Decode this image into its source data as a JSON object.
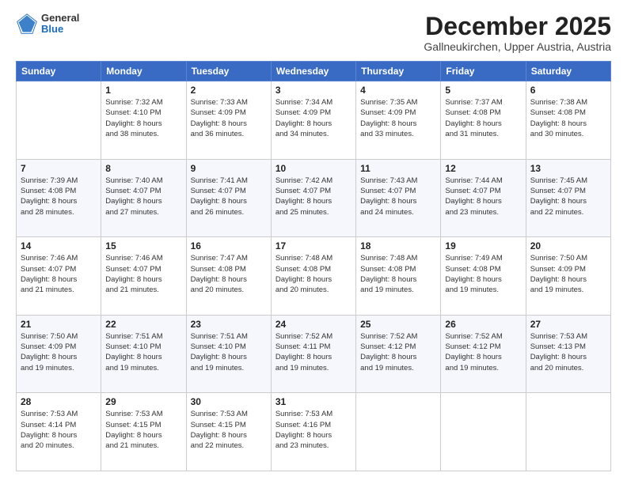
{
  "logo": {
    "general": "General",
    "blue": "Blue"
  },
  "title": "December 2025",
  "location": "Gallneukirchen, Upper Austria, Austria",
  "weekdays": [
    "Sunday",
    "Monday",
    "Tuesday",
    "Wednesday",
    "Thursday",
    "Friday",
    "Saturday"
  ],
  "weeks": [
    [
      {
        "day": "",
        "info": ""
      },
      {
        "day": "1",
        "info": "Sunrise: 7:32 AM\nSunset: 4:10 PM\nDaylight: 8 hours\nand 38 minutes."
      },
      {
        "day": "2",
        "info": "Sunrise: 7:33 AM\nSunset: 4:09 PM\nDaylight: 8 hours\nand 36 minutes."
      },
      {
        "day": "3",
        "info": "Sunrise: 7:34 AM\nSunset: 4:09 PM\nDaylight: 8 hours\nand 34 minutes."
      },
      {
        "day": "4",
        "info": "Sunrise: 7:35 AM\nSunset: 4:09 PM\nDaylight: 8 hours\nand 33 minutes."
      },
      {
        "day": "5",
        "info": "Sunrise: 7:37 AM\nSunset: 4:08 PM\nDaylight: 8 hours\nand 31 minutes."
      },
      {
        "day": "6",
        "info": "Sunrise: 7:38 AM\nSunset: 4:08 PM\nDaylight: 8 hours\nand 30 minutes."
      }
    ],
    [
      {
        "day": "7",
        "info": "Sunrise: 7:39 AM\nSunset: 4:08 PM\nDaylight: 8 hours\nand 28 minutes."
      },
      {
        "day": "8",
        "info": "Sunrise: 7:40 AM\nSunset: 4:07 PM\nDaylight: 8 hours\nand 27 minutes."
      },
      {
        "day": "9",
        "info": "Sunrise: 7:41 AM\nSunset: 4:07 PM\nDaylight: 8 hours\nand 26 minutes."
      },
      {
        "day": "10",
        "info": "Sunrise: 7:42 AM\nSunset: 4:07 PM\nDaylight: 8 hours\nand 25 minutes."
      },
      {
        "day": "11",
        "info": "Sunrise: 7:43 AM\nSunset: 4:07 PM\nDaylight: 8 hours\nand 24 minutes."
      },
      {
        "day": "12",
        "info": "Sunrise: 7:44 AM\nSunset: 4:07 PM\nDaylight: 8 hours\nand 23 minutes."
      },
      {
        "day": "13",
        "info": "Sunrise: 7:45 AM\nSunset: 4:07 PM\nDaylight: 8 hours\nand 22 minutes."
      }
    ],
    [
      {
        "day": "14",
        "info": "Sunrise: 7:46 AM\nSunset: 4:07 PM\nDaylight: 8 hours\nand 21 minutes."
      },
      {
        "day": "15",
        "info": "Sunrise: 7:46 AM\nSunset: 4:07 PM\nDaylight: 8 hours\nand 21 minutes."
      },
      {
        "day": "16",
        "info": "Sunrise: 7:47 AM\nSunset: 4:08 PM\nDaylight: 8 hours\nand 20 minutes."
      },
      {
        "day": "17",
        "info": "Sunrise: 7:48 AM\nSunset: 4:08 PM\nDaylight: 8 hours\nand 20 minutes."
      },
      {
        "day": "18",
        "info": "Sunrise: 7:48 AM\nSunset: 4:08 PM\nDaylight: 8 hours\nand 19 minutes."
      },
      {
        "day": "19",
        "info": "Sunrise: 7:49 AM\nSunset: 4:08 PM\nDaylight: 8 hours\nand 19 minutes."
      },
      {
        "day": "20",
        "info": "Sunrise: 7:50 AM\nSunset: 4:09 PM\nDaylight: 8 hours\nand 19 minutes."
      }
    ],
    [
      {
        "day": "21",
        "info": "Sunrise: 7:50 AM\nSunset: 4:09 PM\nDaylight: 8 hours\nand 19 minutes."
      },
      {
        "day": "22",
        "info": "Sunrise: 7:51 AM\nSunset: 4:10 PM\nDaylight: 8 hours\nand 19 minutes."
      },
      {
        "day": "23",
        "info": "Sunrise: 7:51 AM\nSunset: 4:10 PM\nDaylight: 8 hours\nand 19 minutes."
      },
      {
        "day": "24",
        "info": "Sunrise: 7:52 AM\nSunset: 4:11 PM\nDaylight: 8 hours\nand 19 minutes."
      },
      {
        "day": "25",
        "info": "Sunrise: 7:52 AM\nSunset: 4:12 PM\nDaylight: 8 hours\nand 19 minutes."
      },
      {
        "day": "26",
        "info": "Sunrise: 7:52 AM\nSunset: 4:12 PM\nDaylight: 8 hours\nand 19 minutes."
      },
      {
        "day": "27",
        "info": "Sunrise: 7:53 AM\nSunset: 4:13 PM\nDaylight: 8 hours\nand 20 minutes."
      }
    ],
    [
      {
        "day": "28",
        "info": "Sunrise: 7:53 AM\nSunset: 4:14 PM\nDaylight: 8 hours\nand 20 minutes."
      },
      {
        "day": "29",
        "info": "Sunrise: 7:53 AM\nSunset: 4:15 PM\nDaylight: 8 hours\nand 21 minutes."
      },
      {
        "day": "30",
        "info": "Sunrise: 7:53 AM\nSunset: 4:15 PM\nDaylight: 8 hours\nand 22 minutes."
      },
      {
        "day": "31",
        "info": "Sunrise: 7:53 AM\nSunset: 4:16 PM\nDaylight: 8 hours\nand 23 minutes."
      },
      {
        "day": "",
        "info": ""
      },
      {
        "day": "",
        "info": ""
      },
      {
        "day": "",
        "info": ""
      }
    ]
  ]
}
